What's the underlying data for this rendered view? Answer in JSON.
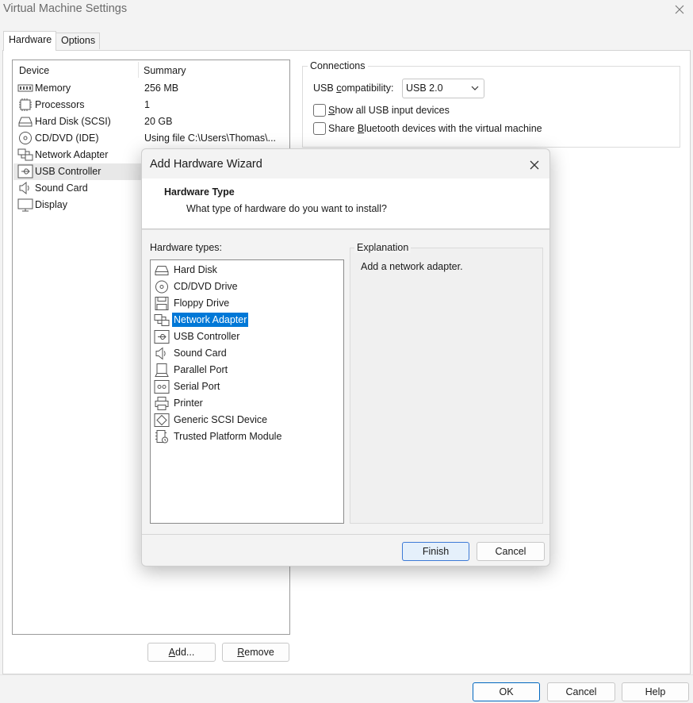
{
  "window": {
    "title": "Virtual Machine Settings"
  },
  "tabs": [
    {
      "label": "Hardware",
      "active": true
    },
    {
      "label": "Options",
      "active": false
    }
  ],
  "device_table": {
    "headers": {
      "device": "Device",
      "summary": "Summary"
    },
    "rows": [
      {
        "icon": "memory-icon",
        "name": "Memory",
        "summary": "256 MB"
      },
      {
        "icon": "processor-icon",
        "name": "Processors",
        "summary": "1"
      },
      {
        "icon": "hard-disk-icon",
        "name": "Hard Disk (SCSI)",
        "summary": "20 GB"
      },
      {
        "icon": "cd-dvd-icon",
        "name": "CD/DVD (IDE)",
        "summary": "Using file C:\\Users\\Thomas\\..."
      },
      {
        "icon": "network-adapter-icon",
        "name": "Network Adapter",
        "summary": ""
      },
      {
        "icon": "usb-controller-icon",
        "name": "USB Controller",
        "summary": "",
        "selected": true
      },
      {
        "icon": "sound-card-icon",
        "name": "Sound Card",
        "summary": ""
      },
      {
        "icon": "display-icon",
        "name": "Display",
        "summary": ""
      }
    ]
  },
  "connections": {
    "legend": "Connections",
    "usb_compat_label_pre": "USB ",
    "usb_compat_label_u": "c",
    "usb_compat_label_post": "ompatibility:",
    "usb_compat_value": "USB 2.0",
    "show_all_pre": "",
    "show_all_u": "S",
    "show_all_post": "how all USB input devices",
    "show_all_checked": false,
    "share_bt_pre": "Share ",
    "share_bt_u": "B",
    "share_bt_post": "luetooth devices with the virtual machine",
    "share_bt_checked": false
  },
  "list_buttons": {
    "add_u": "A",
    "add_post": "dd...",
    "remove_u": "R",
    "remove_post": "emove"
  },
  "footer": {
    "ok": "OK",
    "cancel": "Cancel",
    "help": "Help"
  },
  "dialog": {
    "title": "Add Hardware Wizard",
    "header_title": "Hardware Type",
    "header_subtitle": "What type of hardware do you want to install?",
    "types_label": "Hardware types:",
    "types": [
      {
        "icon": "hard-disk-icon",
        "name": "Hard Disk"
      },
      {
        "icon": "cd-dvd-icon",
        "name": "CD/DVD Drive"
      },
      {
        "icon": "floppy-icon",
        "name": "Floppy Drive"
      },
      {
        "icon": "network-adapter-icon",
        "name": "Network Adapter",
        "selected": true
      },
      {
        "icon": "usb-controller-icon",
        "name": "USB Controller"
      },
      {
        "icon": "sound-card-icon",
        "name": "Sound Card"
      },
      {
        "icon": "parallel-port-icon",
        "name": "Parallel Port"
      },
      {
        "icon": "serial-port-icon",
        "name": "Serial Port"
      },
      {
        "icon": "printer-icon",
        "name": "Printer"
      },
      {
        "icon": "scsi-device-icon",
        "name": "Generic SCSI Device"
      },
      {
        "icon": "tpm-icon",
        "name": "Trusted Platform Module"
      }
    ],
    "explanation_legend": "Explanation",
    "explanation_text": "Add a network adapter.",
    "finish": "Finish",
    "cancel": "Cancel"
  }
}
